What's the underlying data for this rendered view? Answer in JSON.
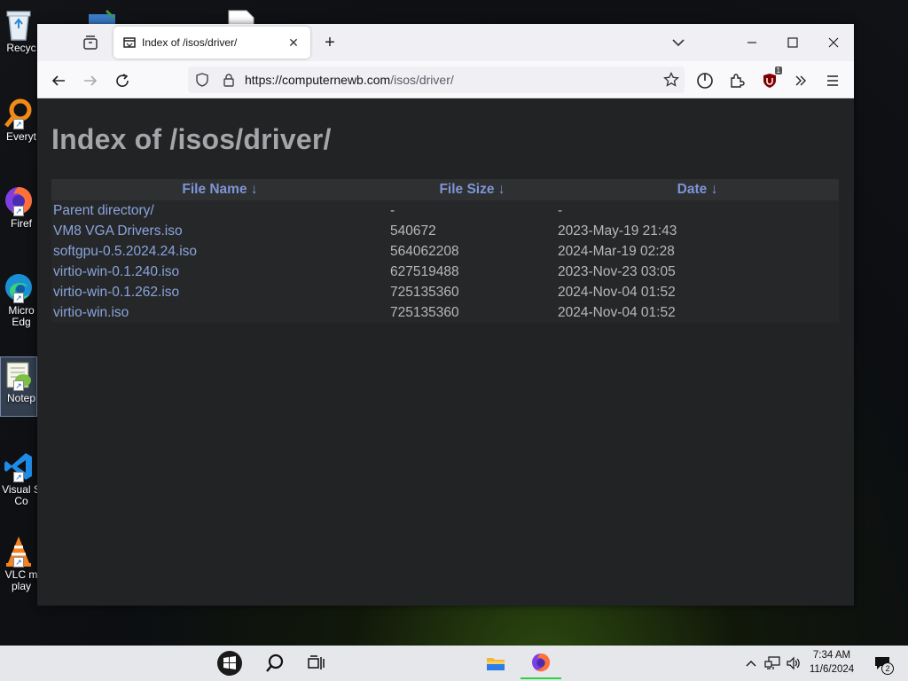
{
  "desktop": {
    "icons": [
      {
        "label": "Recyc"
      },
      {
        "label": "Everyt"
      },
      {
        "label": "Firef"
      },
      {
        "label": "Micro",
        "label2": "Edg"
      },
      {
        "label": "Notep"
      },
      {
        "label": "Visual S",
        "label2": "Co"
      },
      {
        "label": "VLC m",
        "label2": "play"
      }
    ]
  },
  "browser": {
    "tab_title": "Index of /isos/driver/",
    "url_base": "https://computernewb.com",
    "url_path": "/isos/driver/",
    "extension_badge": "1"
  },
  "page": {
    "title": "Index of /isos/driver/"
  },
  "listing": {
    "headers": [
      "File Name  ↓",
      "File Size  ↓",
      "Date  ↓"
    ],
    "rows": [
      {
        "name": "Parent directory/",
        "size": "-",
        "date": "-"
      },
      {
        "name": "VM8 VGA Drivers.iso",
        "size": "540672",
        "date": "2023-May-19 21:43"
      },
      {
        "name": "softgpu-0.5.2024.24.iso",
        "size": "564062208",
        "date": "2024-Mar-19 02:28"
      },
      {
        "name": "virtio-win-0.1.240.iso",
        "size": "627519488",
        "date": "2023-Nov-23 03:05"
      },
      {
        "name": "virtio-win-0.1.262.iso",
        "size": "725135360",
        "date": "2024-Nov-04 01:52"
      },
      {
        "name": "virtio-win.iso",
        "size": "725135360",
        "date": "2024-Nov-04 01:52"
      }
    ]
  },
  "taskbar": {
    "time": "7:34 AM",
    "date": "11/6/2024",
    "notification_count": "2"
  },
  "colors": {
    "page_bg": "#222324",
    "link": "#8aa4de",
    "header_link": "#7e95d6",
    "title": "#a4a6a9"
  }
}
